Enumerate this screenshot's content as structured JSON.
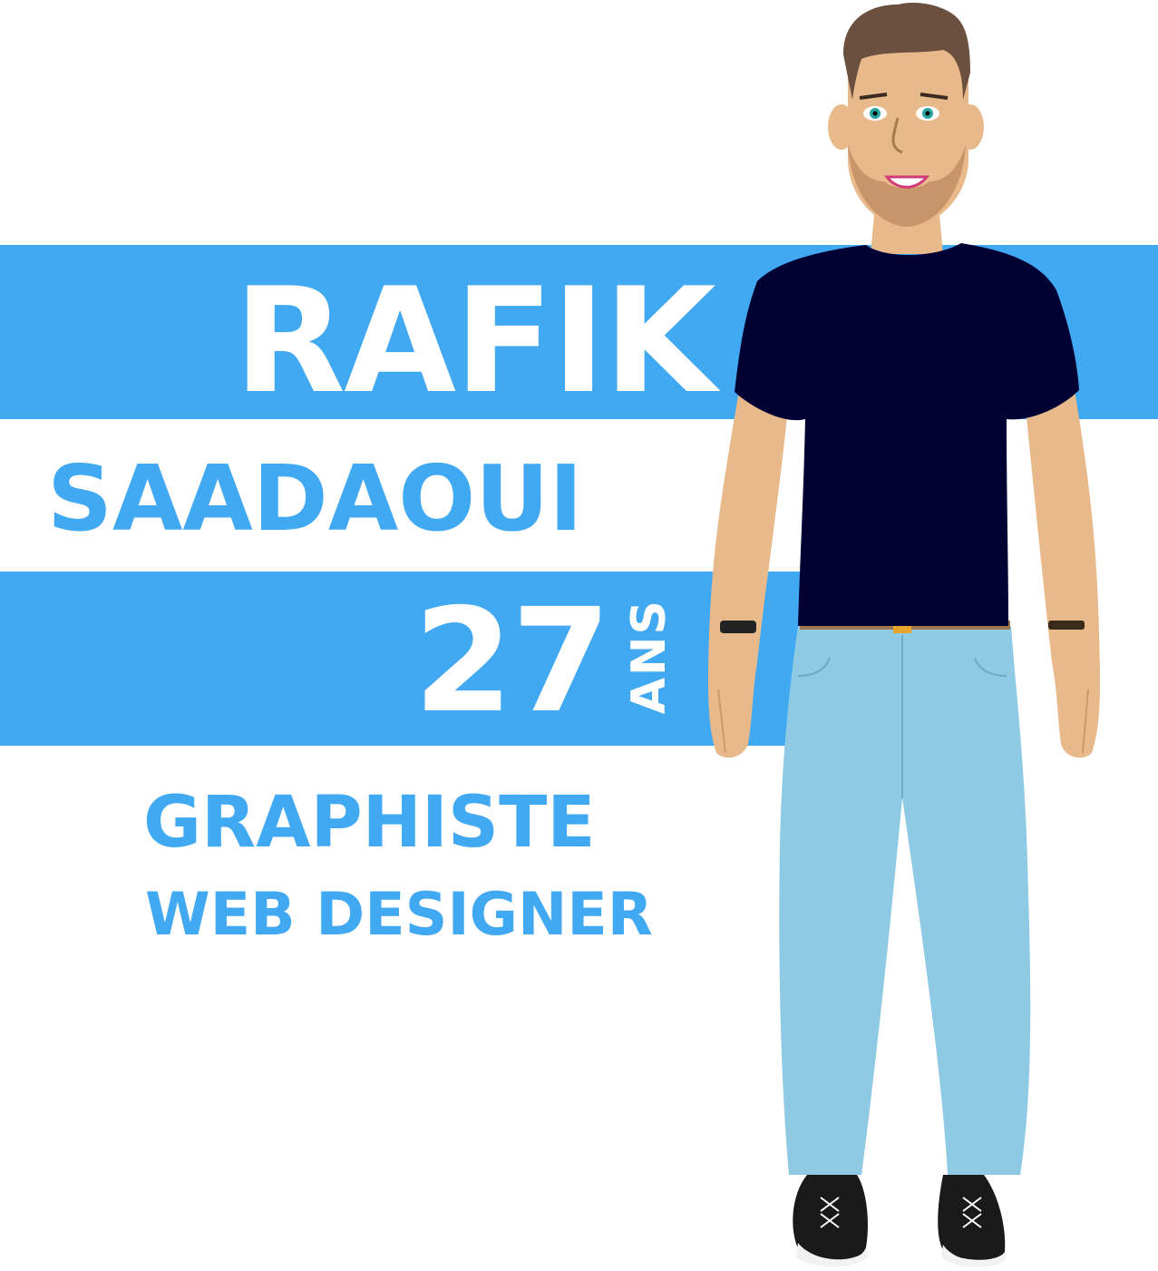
{
  "profile": {
    "first_name": "RAFIK",
    "last_name": "SAADAOUI",
    "age_number": "27",
    "age_unit": "ANS",
    "title": "GRAPHISTE",
    "subtitle": "WEB DESIGNER"
  },
  "colors": {
    "accent": "#41a8f2",
    "background": "#ffffff",
    "shirt": "#000033",
    "jeans": "#8ecae4",
    "skin": "#e8b98a",
    "hair": "#6b5040"
  },
  "illustration": {
    "icon": "cartoon-man-avatar"
  }
}
